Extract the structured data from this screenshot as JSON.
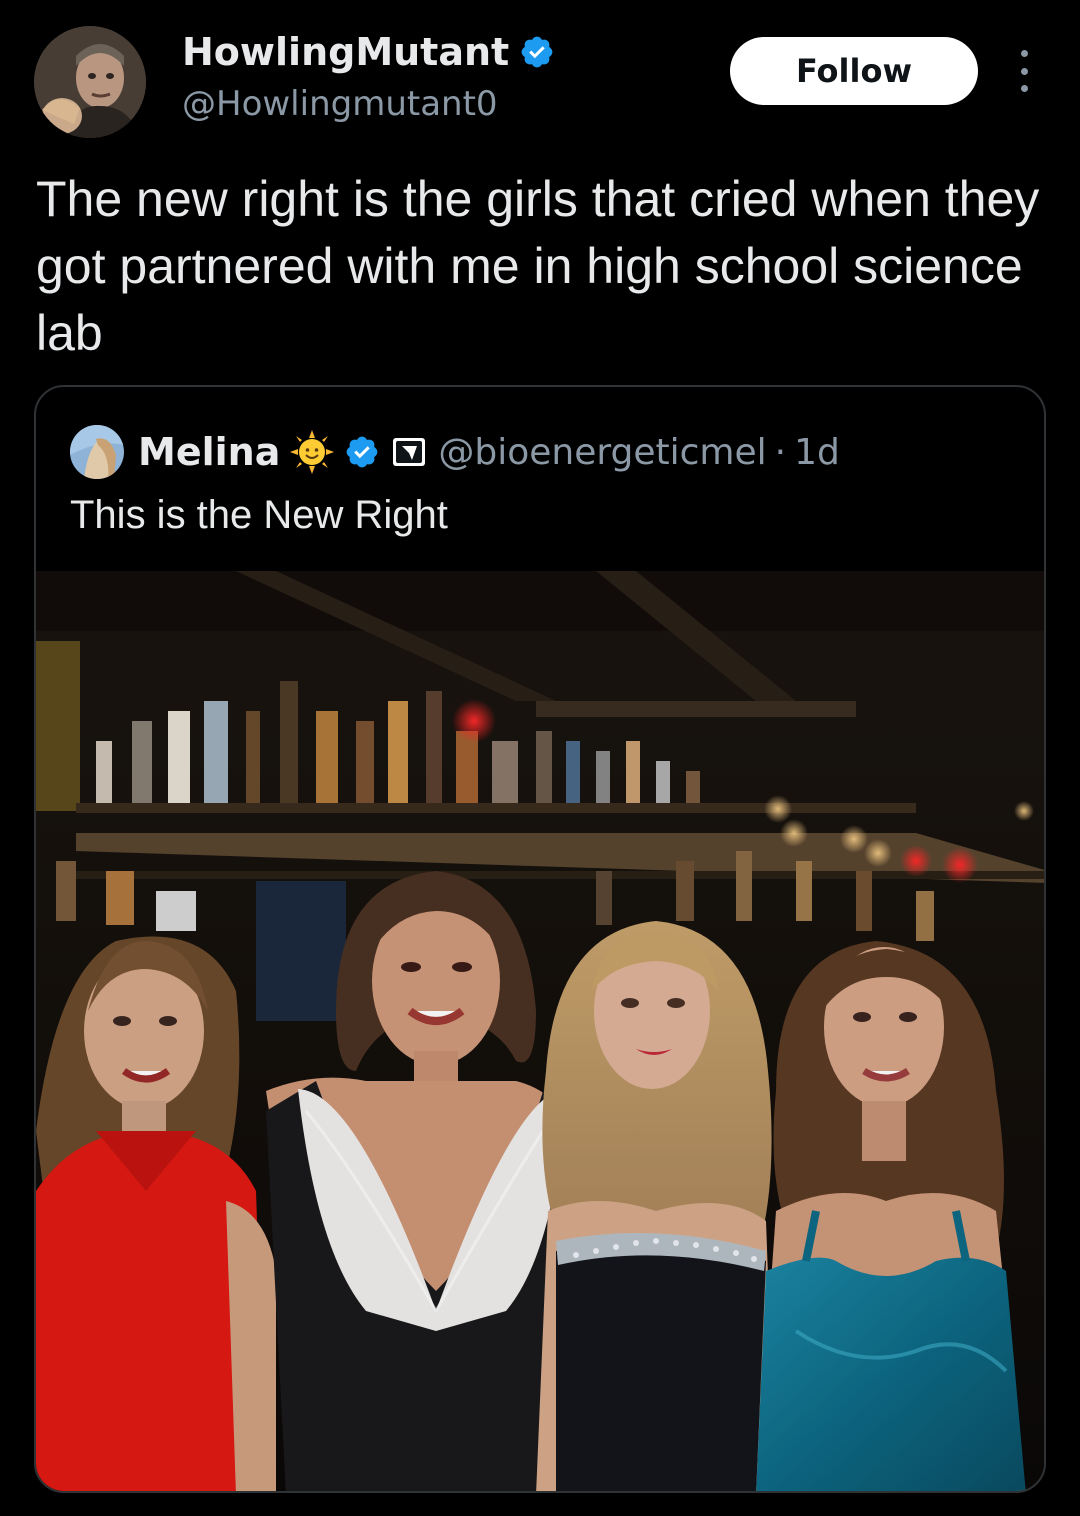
{
  "author": {
    "display_name": "HowlingMutant",
    "handle": "@Howlingmutant0",
    "verified": true,
    "avatar_icon": "profile-avatar"
  },
  "actions": {
    "follow_label": "Follow",
    "more_icon": "more-vertical-icon"
  },
  "tweet": {
    "text": "The new right is the girls that cried when they got partnered with me in high school science lab"
  },
  "quote": {
    "display_name": "Melina",
    "emoji_icon": "sun-with-face-icon",
    "verified": true,
    "affiliate_icon": "affiliate-badge-icon",
    "handle": "@bioenergeticmel",
    "separator": "·",
    "time": "1d",
    "text": "This is the New Right",
    "media_icon": "photo-four-women-at-bar"
  },
  "colors": {
    "background": "#000000",
    "text_primary": "#e7e9ea",
    "text_secondary": "#8b98a5",
    "verified_blue": "#1d9bf0",
    "border": "#2f3336",
    "follow_bg": "#ffffff"
  }
}
